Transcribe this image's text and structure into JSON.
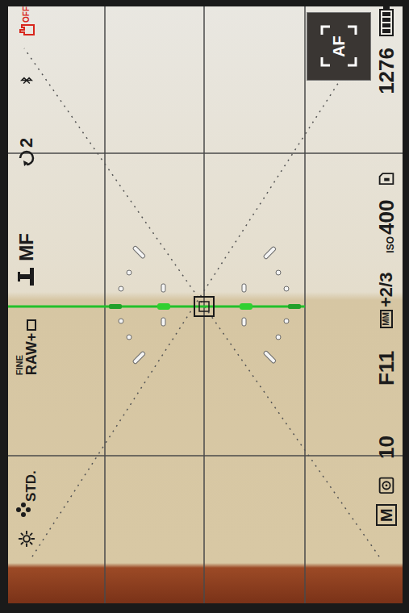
{
  "status_top": {
    "creative_style": "STD.",
    "file_format": "RAW+",
    "quality": "FINE",
    "focus_mode": "MF",
    "drive_count": "2",
    "steadyshot": "OFF"
  },
  "status_bottom": {
    "mode": "M",
    "shutter": "10",
    "aperture": "F11",
    "metering_mode": "MM",
    "exposure_comp": "+2/3",
    "iso_label": "ISO",
    "iso": "400",
    "shots_remaining": "1276"
  },
  "af_button": {
    "label": "AF"
  },
  "battery": {
    "level": 1
  }
}
